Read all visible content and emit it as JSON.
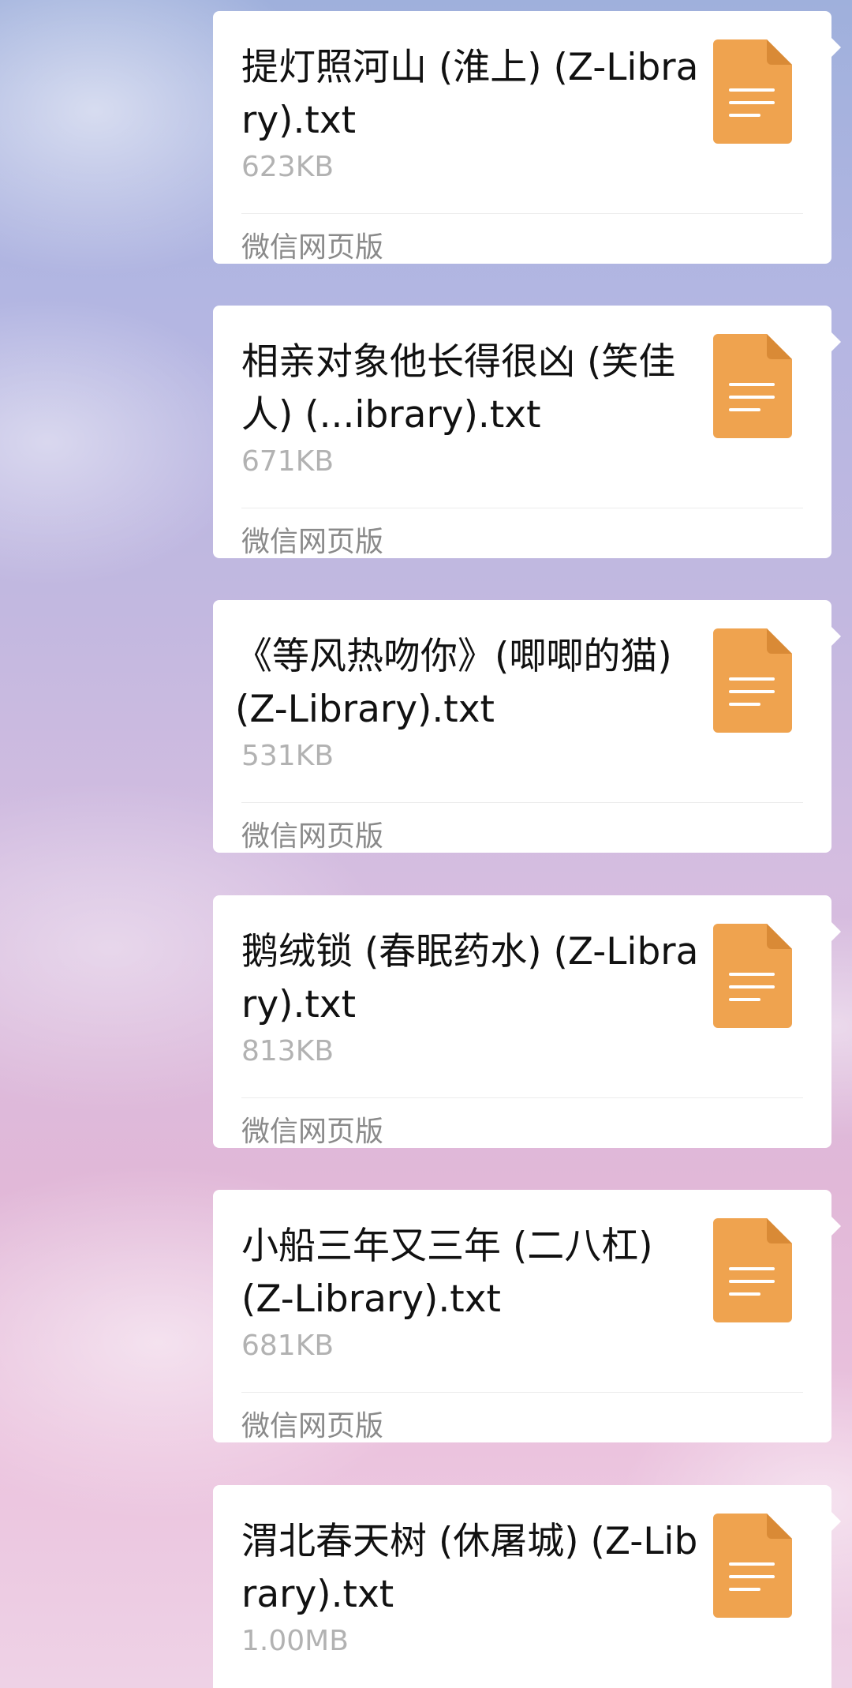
{
  "colors": {
    "card_background": "#ffffff",
    "file_icon": "#efa34f",
    "file_icon_fold": "#d98a36",
    "size_text": "#b2b2b2",
    "source_text": "#8a8a8a"
  },
  "messages": [
    {
      "file_name": "提灯照河山 (淮上) (Z-Library).txt",
      "size": "623KB",
      "source": "微信网页版",
      "icon": "txt-document-icon"
    },
    {
      "file_name": "相亲对象他长得很凶 (笑佳人) (...ibrary).txt",
      "size": "671KB",
      "source": "微信网页版",
      "icon": "txt-document-icon"
    },
    {
      "file_name": "《等风热吻你》(唧唧的猫) (Z-Library).txt",
      "size": "531KB",
      "source": "微信网页版",
      "icon": "txt-document-icon"
    },
    {
      "file_name": "鹅绒锁 (春眠药水) (Z-Library).txt",
      "size": "813KB",
      "source": "微信网页版",
      "icon": "txt-document-icon"
    },
    {
      "file_name": "小船三年又三年 (二八杠) (Z-Library).txt",
      "size": "681KB",
      "source": "微信网页版",
      "icon": "txt-document-icon"
    },
    {
      "file_name": "渭北春天树 (休屠城) (Z-Library).txt",
      "size": "1.00MB",
      "source": "",
      "icon": "txt-document-icon"
    }
  ]
}
